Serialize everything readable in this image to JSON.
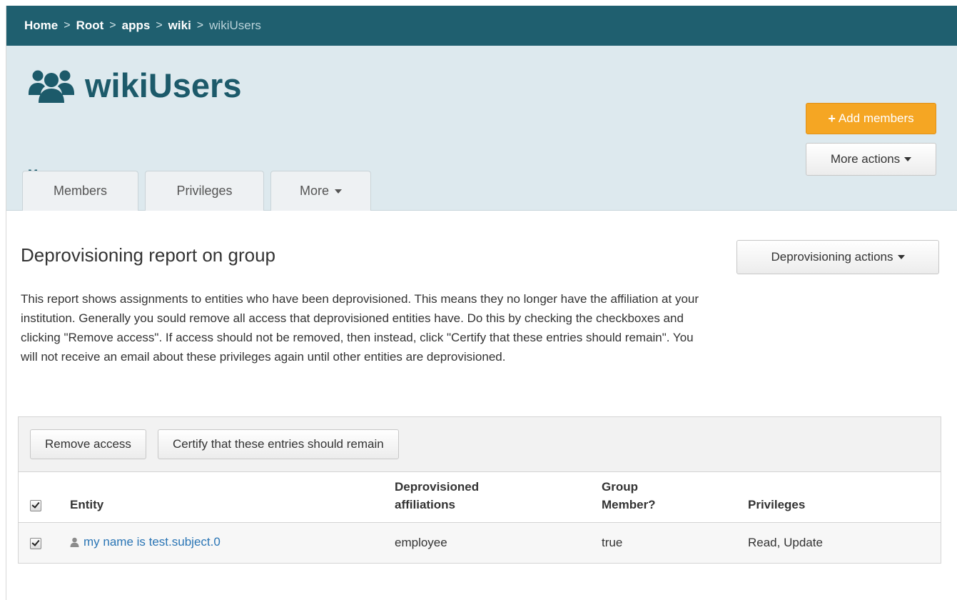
{
  "breadcrumb": {
    "items": [
      "Home",
      "Root",
      "apps",
      "wiki"
    ],
    "current": "wikiUsers",
    "separator": ">"
  },
  "header": {
    "title": "wikiUsers",
    "more_label": "More",
    "add_members_label": "Add members",
    "more_actions_label": "More actions"
  },
  "tabs": [
    {
      "label": "Members"
    },
    {
      "label": "Privileges"
    },
    {
      "label": "More"
    }
  ],
  "report": {
    "title": "Deprovisioning report on group",
    "actions_label": "Deprovisioning actions",
    "description": "This report shows assignments to entities who have been deprovisioned. This means they no longer have the affiliation at your institution. Generally you sould remove all access that deprovisioned entities have. Do this by checking the checkboxes and clicking \"Remove access\". If access should not be removed, then instead, click \"Certify that these entries should remain\". You will not receive an email about these privileges again until other entities are deprovisioned.",
    "remove_access_label": "Remove access",
    "certify_label": "Certify that these entries should remain"
  },
  "table": {
    "columns": [
      "Entity",
      "Deprovisioned affiliations",
      "Group Member?",
      "Privileges"
    ],
    "select_all_checked": true,
    "rows": [
      {
        "checked": true,
        "entity": "my name is test.subject.0",
        "affiliations": "employee",
        "group_member": "true",
        "privileges": "Read, Update"
      }
    ]
  },
  "colors": {
    "breadcrumb_bg": "#1f5f6f",
    "header_bg": "#dde9ee",
    "title_color": "#1c5a6a",
    "accent_orange": "#f5a623",
    "link_blue": "#2a75b5"
  },
  "icons": {
    "title_icon": "users-group-icon",
    "entity_icon": "user-icon",
    "add_icon": "plus-icon",
    "dropdown": "caret-down-icon"
  }
}
